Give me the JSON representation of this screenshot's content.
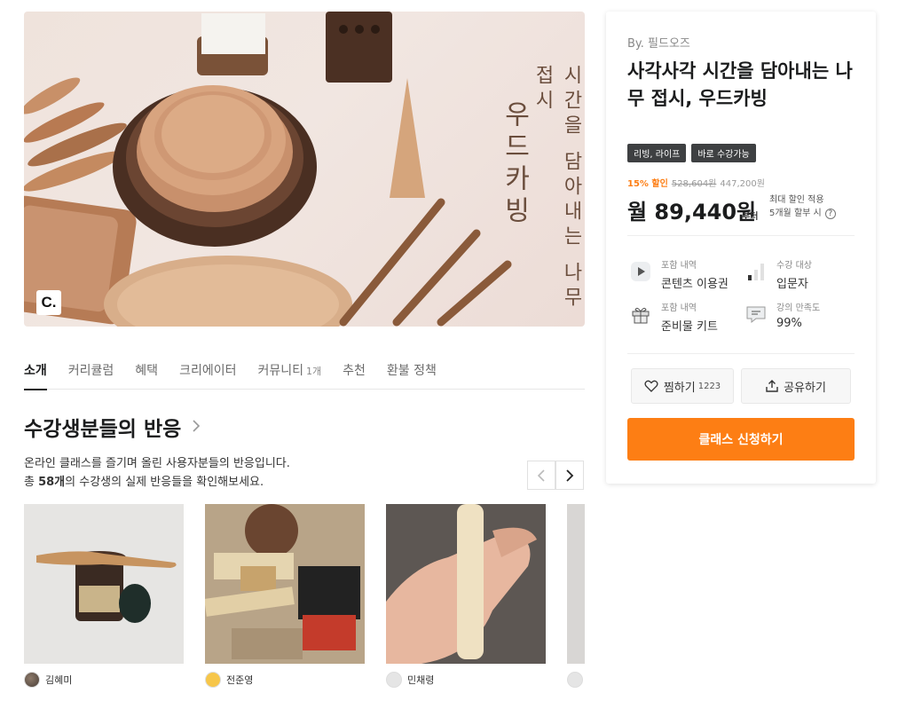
{
  "hero": {
    "title_main": "우드카빙",
    "title_sub": "시간을 담아내는 나무접시",
    "logo_letter": "C."
  },
  "tabs": [
    {
      "label": "소개",
      "active": true
    },
    {
      "label": "커리큘럼"
    },
    {
      "label": "혜택"
    },
    {
      "label": "크리에이터"
    },
    {
      "label": "커뮤니티",
      "count": "1개"
    },
    {
      "label": "추천"
    },
    {
      "label": "환불 정책"
    }
  ],
  "reviews": {
    "title": "수강생분들의 반응",
    "desc_line1": "온라인 클래스를 즐기며 올린 사용자분들의 반응입니다.",
    "desc_prefix": "총 ",
    "desc_count": "58개",
    "desc_suffix": "의 수강생의 실제 반응들을 확인해보세요.",
    "items": [
      {
        "name": "김혜미"
      },
      {
        "name": "전준영"
      },
      {
        "name": "민채령"
      }
    ]
  },
  "card": {
    "by": "By. 필드오즈",
    "title": "사각사각 시간을 담아내는 나무 접시, 우드카빙",
    "chips": [
      "리빙, 라이프",
      "바로 수강가능"
    ],
    "discount": "15% 할인",
    "original_price": "528,604원",
    "sale_price": "447,200원",
    "monthly_price": "월 89,440원",
    "from_label": "부터",
    "installment_line1": "최대 할인 적용",
    "installment_line2": "5개월 할부 시",
    "info": [
      {
        "label": "포함 내역",
        "value": "콘텐츠 이용권",
        "icon": "play-icon"
      },
      {
        "label": "수강 대상",
        "value": "입문자",
        "icon": "signal-bars-icon"
      },
      {
        "label": "포함 내역",
        "value": "준비물 키트",
        "icon": "gift-icon"
      },
      {
        "label": "강의 만족도",
        "value": "99%",
        "icon": "chat-icon"
      }
    ],
    "like_label": "찜하기",
    "like_count": "1223",
    "share_label": "공유하기",
    "cta_label": "클래스 신청하기"
  },
  "colors": {
    "accent": "#fd7e14",
    "chip_bg": "#3e4042"
  }
}
